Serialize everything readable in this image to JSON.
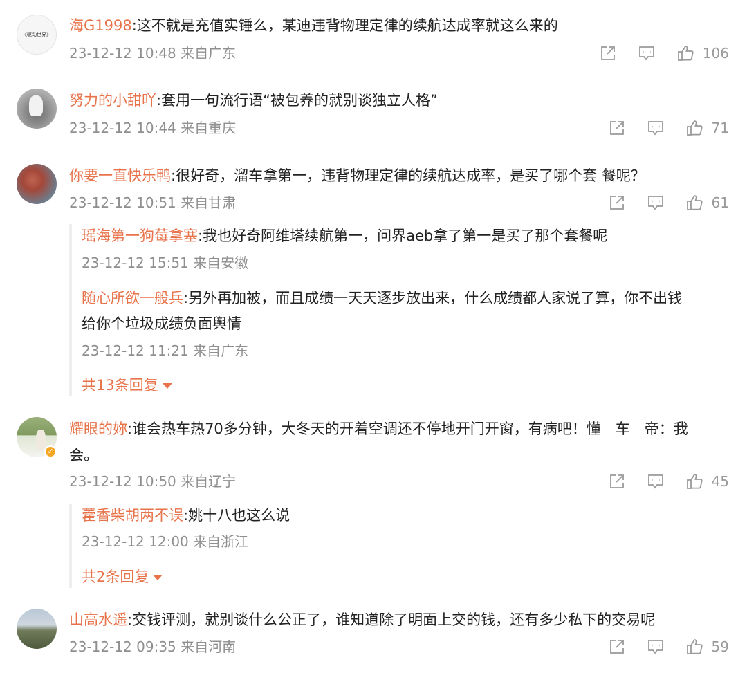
{
  "comments": [
    {
      "username": "海G1998",
      "text": ":这不就是充值实锤么，某迪违背物理定律的续航达成率就这么来的",
      "time": "23-12-12 10:48 来自广东",
      "likes": "106",
      "avatar_text": "《驱动世界》"
    },
    {
      "username": "努力的小甜吖",
      "text": ":套用一句流行语“被包养的就别谈独立人格”",
      "time": "23-12-12 10:44 来自重庆",
      "likes": "71"
    },
    {
      "username": "你要一直快乐鸭",
      "text": ":很好奇，溜车拿第一，违背物理定律的续航达成率，是买了哪个套 餐呢？",
      "time": "23-12-12 10:51 来自甘肃",
      "likes": "61",
      "replies": [
        {
          "username": "瑶海第一狗莓拿塞",
          "text": ":我也好奇阿维塔续航第一，问界aeb拿了第一是买了那个套餐呢",
          "time": "23-12-12 15:51 来自安徽"
        },
        {
          "username": "随心所欲一般兵",
          "text_line1": ":另外再加被，而且成绩一天天逐步放出来，什么成绩都人家说了算，你不出钱",
          "text_line2": "给你个垃圾成绩负面舆情",
          "time": "23-12-12 11:21 来自广东"
        }
      ],
      "more_replies": "共13条回复"
    },
    {
      "username": "耀眼的妳",
      "text_line1": ":谁会热车热70多分钟，大冬天的开着空调还不停地开门开窗，有病吧！懂　车　帝：我",
      "text_line2": "会。",
      "time": "23-12-12 10:50 来自辽宁",
      "likes": "45",
      "replies": [
        {
          "username": "藿香柴胡两不误",
          "text": ":姚十八也这么说",
          "time": "23-12-12 12:00 来自浙江"
        }
      ],
      "more_replies": "共2条回复"
    },
    {
      "username": "山高水遥",
      "text": ":交钱评测，就别谈什么公正了，谁知道除了明面上交的钱，还有多少私下的交易呢",
      "time": "23-12-12 09:35 来自河南",
      "likes": "59"
    }
  ],
  "icons": {
    "share": "share-icon",
    "comment": "comment-icon",
    "like": "thumbs-up-icon"
  },
  "colors": {
    "username": "#e8734a",
    "meta": "#8f8f8f",
    "icon": "#9a9a9a"
  }
}
